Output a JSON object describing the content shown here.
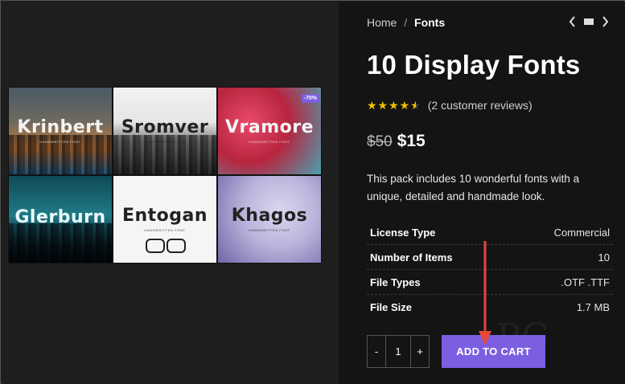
{
  "images": {
    "tiles": [
      {
        "title": "Krinbert",
        "subtitle": "Handwritten Font"
      },
      {
        "title": "Sromver",
        "subtitle": "Handwritten Font"
      },
      {
        "title": "Vramore",
        "subtitle": "Handwritten Font"
      },
      {
        "title": "Glerburn",
        "subtitle": ""
      },
      {
        "title": "Entogan",
        "subtitle": "Handwritten Font"
      },
      {
        "title": "Khagos",
        "subtitle": "Handwritten Font"
      }
    ],
    "badge": "-70%"
  },
  "breadcrumb": {
    "home": "Home",
    "separator": "/",
    "current": "Fonts"
  },
  "nav": {
    "prev_icon": "chevron-left-icon",
    "grid_icon": "grid-icon",
    "next_icon": "chevron-right-icon"
  },
  "product": {
    "title": "10 Display Fonts",
    "rating": {
      "value": 4.5,
      "max": 5,
      "reviews_text": "(2 customer reviews)"
    },
    "price": {
      "old": "$50",
      "new": "$15"
    },
    "description": "This pack includes 10 wonderful fonts with a unique, detailed and handmade look.",
    "specs": [
      {
        "label": "License Type",
        "value": "Commercial"
      },
      {
        "label": "Number of Items",
        "value": "10"
      },
      {
        "label": "File Types",
        "value": ".OTF .TTF"
      },
      {
        "label": "File Size",
        "value": "1.7 MB"
      }
    ],
    "quantity": {
      "minus": "-",
      "value": "1",
      "plus": "+"
    },
    "add_to_cart": "ADD TO CART"
  },
  "colors": {
    "accent": "#7b5fe0",
    "star": "#f0c000",
    "annotation_arrow": "#e8453c"
  }
}
